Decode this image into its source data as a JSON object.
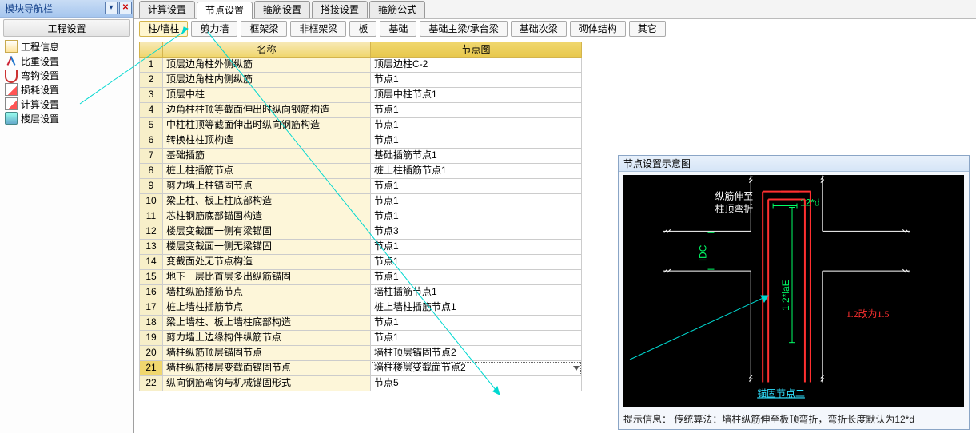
{
  "sidebar": {
    "title": "模块导航栏",
    "pin_icon": "▾",
    "close_icon": "✕",
    "section": "工程设置",
    "items": [
      {
        "label": "工程信息",
        "icon": "doc"
      },
      {
        "label": "比重设置",
        "icon": "fork"
      },
      {
        "label": "弯钩设置",
        "icon": "hook"
      },
      {
        "label": "损耗设置",
        "icon": "edit"
      },
      {
        "label": "计算设置",
        "icon": "edit"
      },
      {
        "label": "楼层设置",
        "icon": "floor"
      }
    ]
  },
  "tabs1": {
    "items": [
      "计算设置",
      "节点设置",
      "箍筋设置",
      "搭接设置",
      "箍筋公式"
    ],
    "active": 1
  },
  "tabs2": {
    "items": [
      "柱/墙柱",
      "剪力墙",
      "框架梁",
      "非框架梁",
      "板",
      "基础",
      "基础主梁/承台梁",
      "基础次梁",
      "砌体结构",
      "其它"
    ],
    "active": 0
  },
  "table": {
    "h_name": "名称",
    "h_img": "节点图",
    "selected": 20,
    "rows": [
      {
        "n": 1,
        "name": "顶层边角柱外侧纵筋",
        "img": "顶层边柱C-2"
      },
      {
        "n": 2,
        "name": "顶层边角柱内侧纵筋",
        "img": "节点1"
      },
      {
        "n": 3,
        "name": "顶层中柱",
        "img": "顶层中柱节点1"
      },
      {
        "n": 4,
        "name": "边角柱柱顶等截面伸出时纵向钢筋构造",
        "img": "节点1"
      },
      {
        "n": 5,
        "name": "中柱柱顶等截面伸出时纵向钢筋构造",
        "img": "节点1"
      },
      {
        "n": 6,
        "name": "转换柱柱顶构造",
        "img": "节点1"
      },
      {
        "n": 7,
        "name": "基础插筋",
        "img": "基础插筋节点1"
      },
      {
        "n": 8,
        "name": "桩上柱插筋节点",
        "img": "桩上柱插筋节点1"
      },
      {
        "n": 9,
        "name": "剪力墙上柱锚固节点",
        "img": "节点1"
      },
      {
        "n": 10,
        "name": "梁上柱、板上柱底部构造",
        "img": "节点1"
      },
      {
        "n": 11,
        "name": "芯柱钢筋底部锚固构造",
        "img": "节点1"
      },
      {
        "n": 12,
        "name": "楼层变截面一侧有梁锚固",
        "img": "节点3"
      },
      {
        "n": 13,
        "name": "楼层变截面一侧无梁锚固",
        "img": "节点1"
      },
      {
        "n": 14,
        "name": "变截面处无节点构造",
        "img": "节点1"
      },
      {
        "n": 15,
        "name": "地下一层比首层多出纵筋锚固",
        "img": "节点1"
      },
      {
        "n": 16,
        "name": "墙柱纵筋插筋节点",
        "img": "墙柱插筋节点1"
      },
      {
        "n": 17,
        "name": "桩上墙柱插筋节点",
        "img": "桩上墙柱插筋节点1"
      },
      {
        "n": 18,
        "name": "梁上墙柱、板上墙柱底部构造",
        "img": "节点1"
      },
      {
        "n": 19,
        "name": "剪力墙上边缘构件纵筋节点",
        "img": "节点1"
      },
      {
        "n": 20,
        "name": "墙柱纵筋顶层锚固节点",
        "img": "墙柱顶层锚固节点2"
      },
      {
        "n": 21,
        "name": "墙柱纵筋楼层变截面锚固节点",
        "img": "墙柱楼层变截面节点2"
      },
      {
        "n": 22,
        "name": "纵向钢筋弯钩与机械锚固形式",
        "img": "节点5"
      }
    ]
  },
  "right": {
    "title": "节点设置示意图",
    "label1": "纵筋伸至",
    "label2": "柱顶弯折",
    "dim_12d": "12*d",
    "dim_idc": "IDC",
    "dim_laE": "1.2*laE",
    "change": "1.2改为1.5",
    "anchor": "锚固节点二",
    "tip": "提示信息：  传统算法：墙柱纵筋伸至板顶弯折，弯折长度默认为12*d"
  }
}
